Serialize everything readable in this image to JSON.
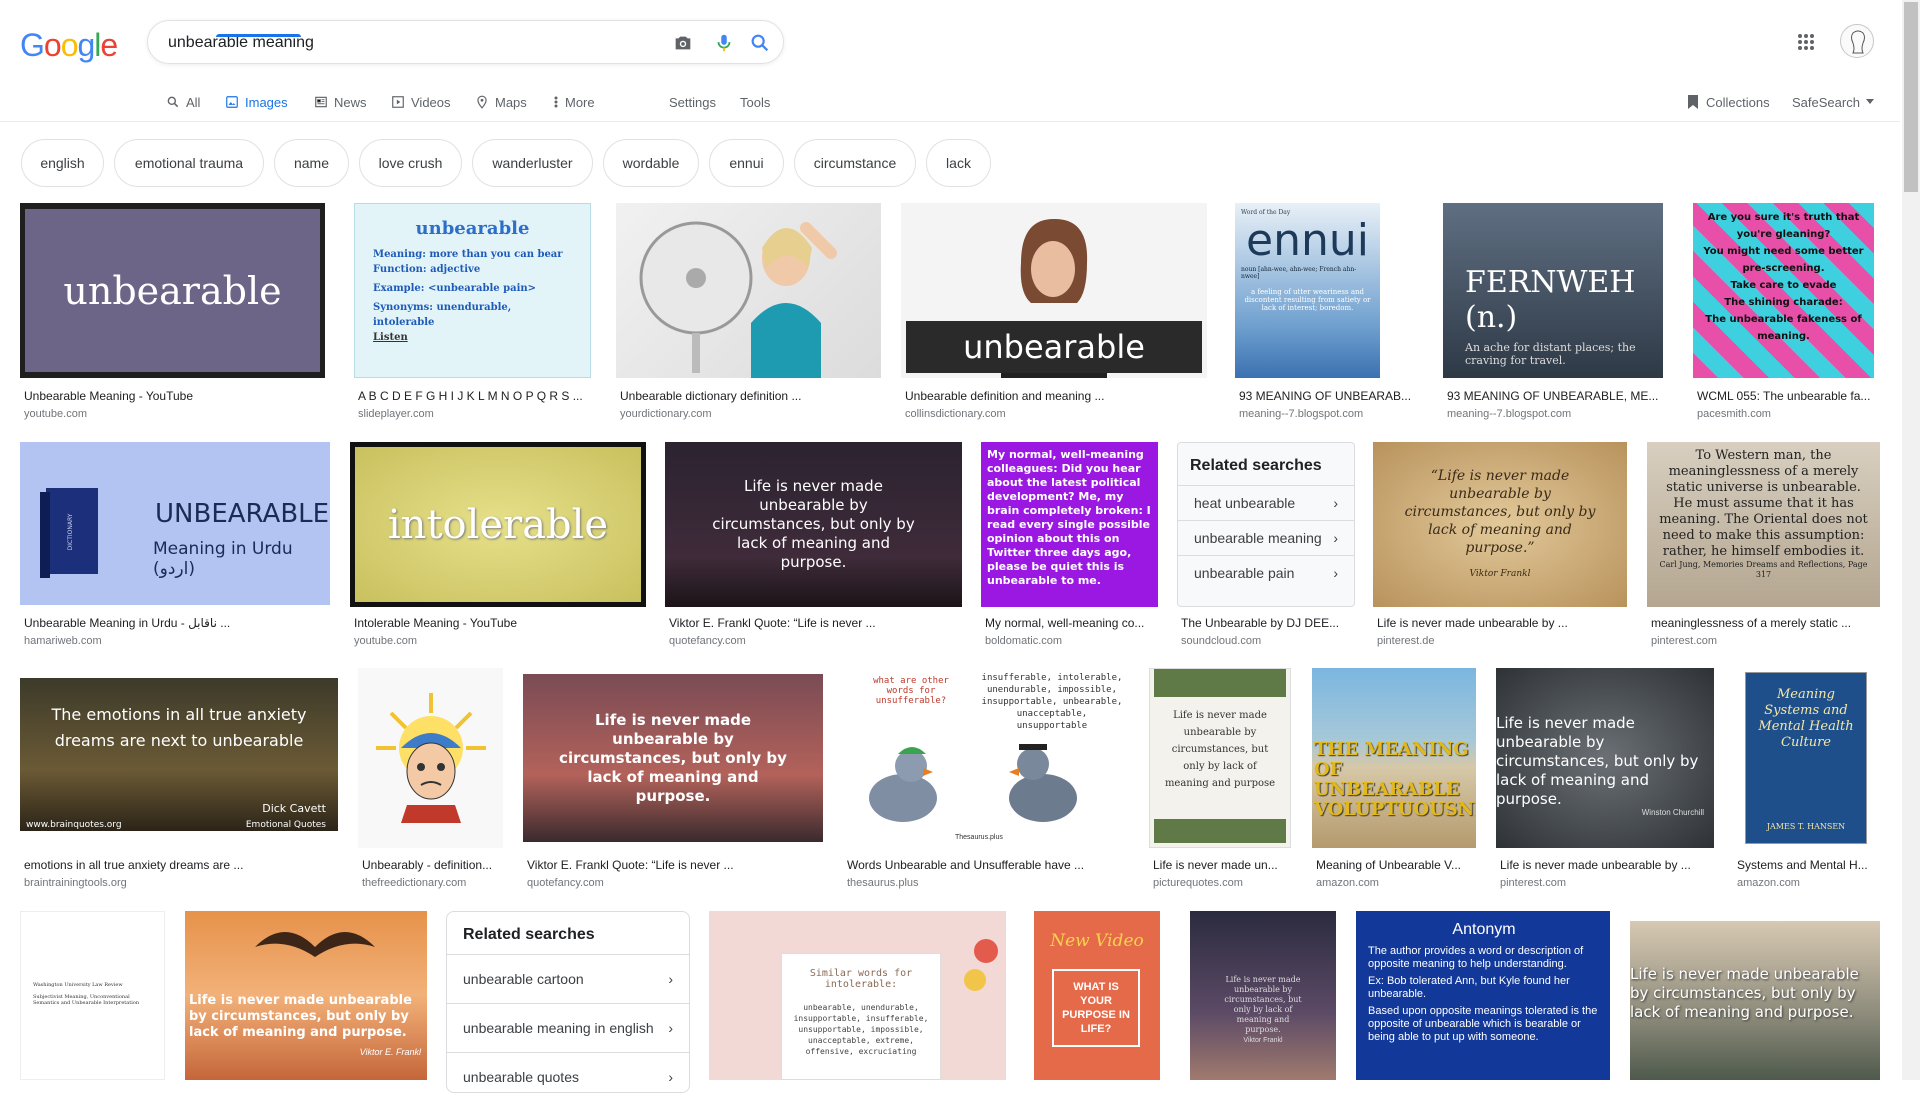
{
  "logo": {
    "letters": [
      "G",
      "o",
      "o",
      "g",
      "l",
      "e"
    ],
    "colors": [
      "#4285F4",
      "#EA4335",
      "#FBBC05",
      "#4285F4",
      "#34A853",
      "#EA4335"
    ]
  },
  "search": {
    "query": "unbearable meaning",
    "icons": [
      "camera-icon",
      "microphone-icon",
      "search-icon"
    ]
  },
  "header": {
    "icons": [
      "apps-grid-icon",
      "account-avatar"
    ]
  },
  "tabs": [
    {
      "label": "All",
      "icon": "search-icon"
    },
    {
      "label": "Images",
      "icon": "image-icon"
    },
    {
      "label": "News",
      "icon": "news-icon"
    },
    {
      "label": "Videos",
      "icon": "video-icon"
    },
    {
      "label": "Maps",
      "icon": "map-icon"
    },
    {
      "label": "More",
      "icon": "more-icon"
    },
    {
      "label": "Settings"
    },
    {
      "label": "Tools"
    }
  ],
  "right_tools": {
    "collections": "Collections",
    "safesearch": "SafeSearch"
  },
  "chips": [
    "english",
    "emotional trauma",
    "name",
    "love crush",
    "wanderluster",
    "wordable",
    "ennui",
    "circumstance",
    "lack"
  ],
  "results": [
    {
      "title": "Unbearable Meaning - YouTube",
      "source": "youtube.com",
      "thumb_text": "unbearable"
    },
    {
      "title": "A B C D E F G H I J K L M N O P Q R S ...",
      "source": "slideplayer.com",
      "thumb_text": "unbearable",
      "thumb_lines": [
        "Meaning: more than you can bear",
        "Function: adjective",
        "Example: <unbearable pain>",
        "Synonyms: unendurable, intolerable",
        "Listen"
      ]
    },
    {
      "title": "Unbearable dictionary definition ...",
      "source": "yourdictionary.com"
    },
    {
      "title": "Unbearable definition and meaning ...",
      "source": "collinsdictionary.com",
      "thumb_text": "unbearable"
    },
    {
      "title": "93 MEANING OF UNBEARAB...",
      "source": "meaning--7.blogspot.com",
      "thumb_text": "ennui",
      "thumb_lines": [
        "Word of the Day",
        "noun [ahn-wee, ahn-wee; French ahn-nwee]",
        "a feeling of utter weariness and discontent resulting from satiety or lack of interest; boredom."
      ]
    },
    {
      "title": "93 MEANING OF UNBEARABLE, ME...",
      "source": "meaning--7.blogspot.com",
      "thumb_text": "FERNWEH (n.)",
      "thumb_lines": [
        "An ache for distant places; the craving for travel."
      ]
    },
    {
      "title": "WCML 055: The unbearable fa...",
      "source": "pacesmith.com",
      "thumb_lines": [
        "Are you sure it's truth that you're gleaning?",
        "You might need some better pre-screening.",
        "Take care to evade",
        "The shining charade:",
        "The unbearable fakeness of meaning."
      ]
    },
    {
      "title": "Unbearable Meaning in Urdu - ناقابل ...",
      "source": "hamariweb.com",
      "thumb_text": "UNBEARABLE",
      "thumb_lines": [
        "Meaning in Urdu (اردو)"
      ]
    },
    {
      "title": "Intolerable Meaning - YouTube",
      "source": "youtube.com",
      "thumb_text": "intolerable"
    },
    {
      "title": "Viktor E. Frankl Quote: “Life is never ...",
      "source": "quotefancy.com",
      "thumb_lines": [
        "Life is never made unbearable by circumstances, but only by lack of meaning and purpose."
      ]
    },
    {
      "title": "My normal, well-meaning co...",
      "source": "boldomatic.com",
      "thumb_lines": [
        "My normal, well-meaning colleagues: Did you hear about the latest political development? Me, my brain completely broken: I read every single possible opinion about this on Twitter three days ago, please be quiet this is unbearable to me."
      ]
    },
    {
      "title": "The Unbearable by DJ DEE...",
      "source": "soundcloud.com"
    },
    {
      "title": "Life is never made unbearable by ...",
      "source": "pinterest.de",
      "thumb_lines": [
        "“Life is never made unbearable by circumstances, but only by lack of meaning and purpose.”",
        "Viktor Frankl"
      ]
    },
    {
      "title": "meaninglessness of a merely static ...",
      "source": "pinterest.com",
      "thumb_lines": [
        "To Western man, the meaninglessness of a merely static universe is unbearable. He must assume that it has meaning. The Oriental does not need to make this assumption: rather, he himself embodies it.",
        "Carl Jung, Memories Dreams and Reflections, Page 317"
      ]
    },
    {
      "title": "emotions in all true anxiety dreams are ...",
      "source": "braintrainingtools.org",
      "thumb_lines": [
        "The emotions in all true anxiety dreams are next to unbearable",
        "Dick Cavett",
        "www.brainquotes.org",
        "Emotional Quotes"
      ]
    },
    {
      "title": "Unbearably - definition...",
      "source": "thefreedictionary.com"
    },
    {
      "title": "Viktor E. Frankl Quote: “Life is never ...",
      "source": "quotefancy.com",
      "thumb_lines": [
        "Life is never made unbearable by circumstances, but only by lack of meaning and purpose."
      ]
    },
    {
      "title": "Words Unbearable and Unsufferable have ...",
      "source": "thesaurus.plus",
      "thumb_lines": [
        "what are other words for unsufferable?",
        "insufferable, intolerable, unendurable, impossible, insupportable, unbearable, unacceptable, unsupportable",
        "Thesaurus.plus"
      ]
    },
    {
      "title": "Life is never made un...",
      "source": "picturequotes.com",
      "thumb_lines": [
        "Life is never made unbearable by circumstances, but only by lack of meaning and purpose"
      ]
    },
    {
      "title": "Meaning of Unbearable V...",
      "source": "amazon.com",
      "thumb_lines": [
        "THE MEANING OF UNBEARABLE VOLUPTUOUSNESS"
      ]
    },
    {
      "title": "Life is never made unbearable by ...",
      "source": "pinterest.com",
      "thumb_lines": [
        "Life is never made unbearable by circumstances, but only by lack of meaning and purpose.",
        "Winston Churchill"
      ]
    },
    {
      "title": "Systems and Mental H...",
      "source": "amazon.com",
      "thumb_lines": [
        "Meaning Systems and Mental Health Culture",
        "JAMES T. HANSEN"
      ]
    }
  ],
  "related1": {
    "title": "Related searches",
    "items": [
      "heat unbearable",
      "unbearable meaning",
      "unbearable pain"
    ]
  },
  "related2": {
    "title": "Related searches",
    "items": [
      "unbearable cartoon",
      "unbearable meaning in english",
      "unbearable quotes"
    ]
  },
  "row4": [
    {
      "thumb_lines": [
        "Washington University Law Review",
        "Subjectivist Meaning, Unconventional Semantics and Unbearable Interpretation"
      ]
    },
    {
      "thumb_lines": [
        "Life is never made unbearable by circumstances, but only by lack of meaning and purpose.",
        "Viktor E. Frankl"
      ]
    },
    {
      "thumb_lines": [
        "Similar words for intolerable:",
        "unbearable, unendurable, insupportable, insufferable, unsupportable, impossible, unacceptable, extreme, offensive, excruciating"
      ]
    },
    {
      "thumb_lines": [
        "New Video",
        "WHAT IS YOUR PURPOSE IN LIFE?"
      ]
    },
    {
      "thumb_lines": [
        "Life is never made unbearable by circumstances, but only by lack of meaning and purpose.",
        "Viktor Frankl"
      ]
    },
    {
      "thumb_lines": [
        "Antonym",
        "The author provides a word or description of opposite meaning to help understanding.",
        "Ex: Bob tolerated Ann, but Kyle found her unbearable.",
        "Based upon opposite meanings tolerated is the opposite of unbearable which is bearable or being able to put up with someone."
      ]
    },
    {
      "thumb_lines": [
        "Life is never made unbearable by circumstances, but only by lack of meaning and purpose."
      ]
    }
  ]
}
